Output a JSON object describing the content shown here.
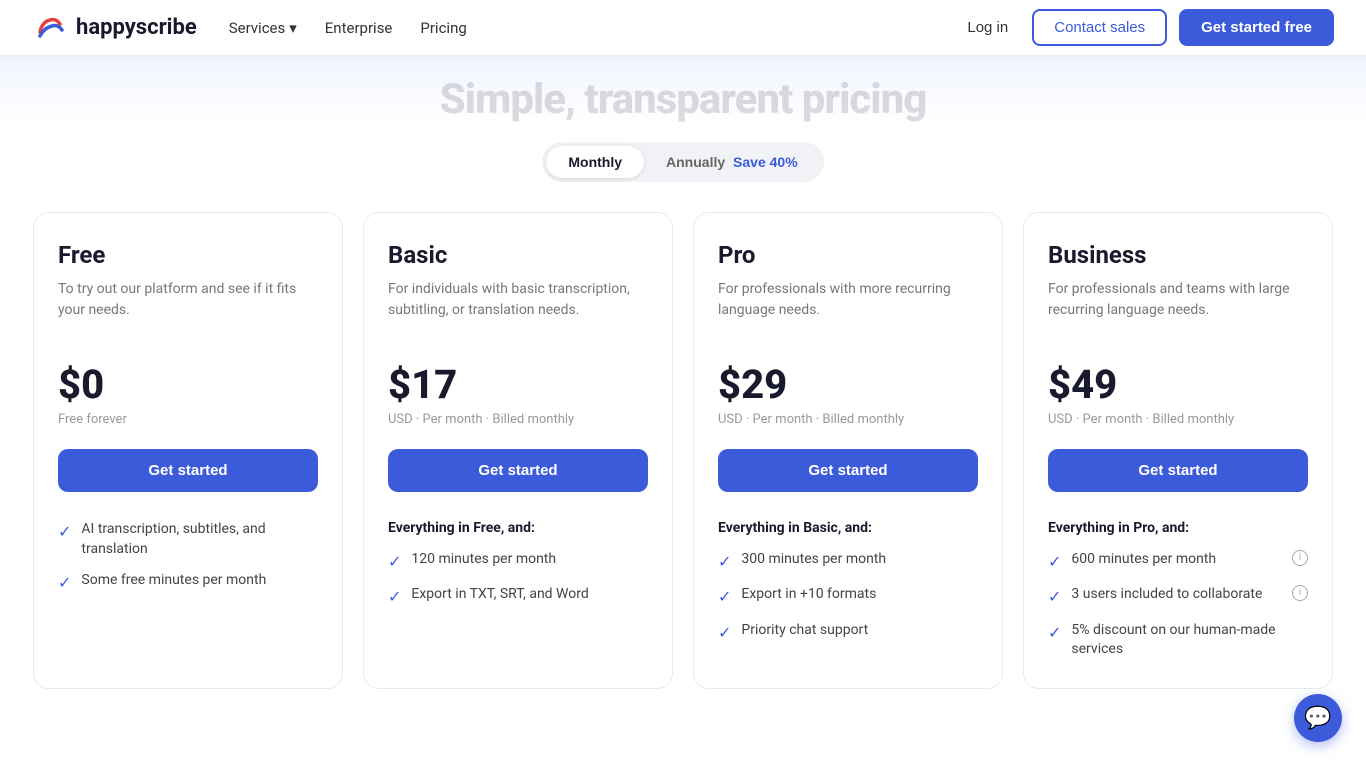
{
  "nav": {
    "logo_text": "happyscribe",
    "links": [
      {
        "label": "Services",
        "hasDropdown": true
      },
      {
        "label": "Enterprise",
        "hasDropdown": false
      },
      {
        "label": "Pricing",
        "hasDropdown": false
      }
    ],
    "login_label": "Log in",
    "contact_label": "Contact sales",
    "getstarted_label": "Get started free"
  },
  "hero": {
    "title_partial": "Simple, transparent pricing"
  },
  "billing_toggle": {
    "monthly_label": "Monthly",
    "annually_label": "Annually",
    "save_label": "Save 40%",
    "active": "monthly"
  },
  "plans": [
    {
      "id": "free",
      "name": "Free",
      "description": "To try out our platform and see if it fits your needs.",
      "price": "$0",
      "billing": "Free forever",
      "cta": "Get started",
      "features_heading": null,
      "features": [
        {
          "text": "AI transcription, subtitles, and translation",
          "info": false
        },
        {
          "text": "Some free minutes per month",
          "info": false
        }
      ]
    },
    {
      "id": "basic",
      "name": "Basic",
      "description": "For individuals with basic transcription, subtitling, or translation needs.",
      "price": "$17",
      "billing": "USD · Per month · Billed monthly",
      "cta": "Get started",
      "features_heading": "Everything in Free, and:",
      "features": [
        {
          "text": "120 minutes per month",
          "info": false
        },
        {
          "text": "Export in TXT, SRT, and Word",
          "info": false
        }
      ]
    },
    {
      "id": "pro",
      "name": "Pro",
      "description": "For professionals with more recurring language needs.",
      "price": "$29",
      "billing": "USD · Per month · Billed monthly",
      "cta": "Get started",
      "features_heading": "Everything in Basic, and:",
      "features": [
        {
          "text": "300 minutes per month",
          "info": false
        },
        {
          "text": "Export in +10 formats",
          "info": false
        },
        {
          "text": "Priority chat support",
          "info": false
        }
      ]
    },
    {
      "id": "business",
      "name": "Business",
      "description": "For professionals and teams with large recurring language needs.",
      "price": "$49",
      "billing": "USD · Per month · Billed monthly",
      "cta": "Get started",
      "features_heading": "Everything in Pro, and:",
      "features": [
        {
          "text": "600 minutes per month",
          "info": true
        },
        {
          "text": "3 users included to collaborate",
          "info": true
        },
        {
          "text": "5% discount on our human-made services",
          "info": false
        }
      ]
    }
  ],
  "chat": {
    "icon": "💬"
  }
}
